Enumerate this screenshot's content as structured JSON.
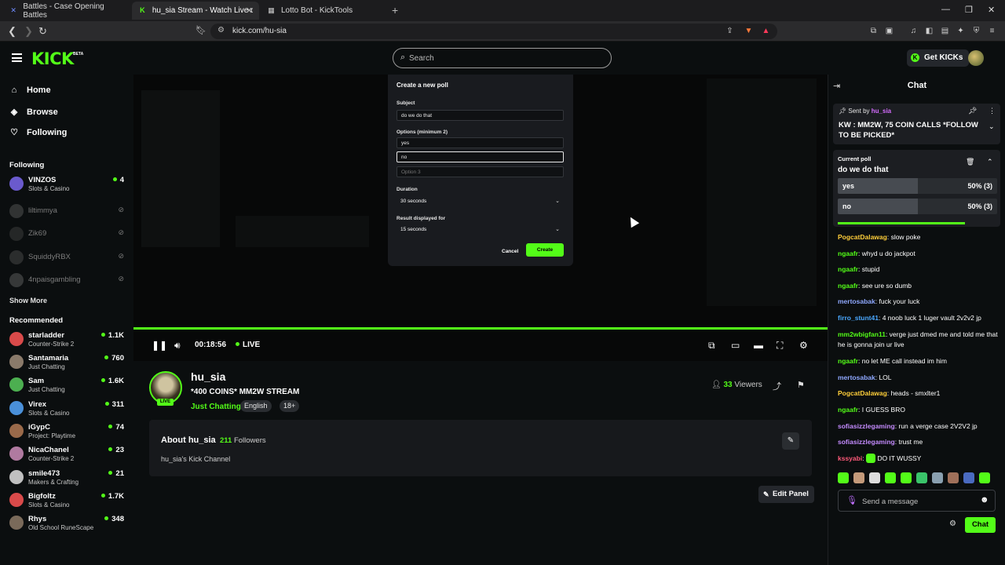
{
  "browser": {
    "tabs": [
      {
        "title": "Battles - Case Opening Battles",
        "icon": "battles-favicon",
        "color": "#6f8cff"
      },
      {
        "title": "hu_sia Stream - Watch Live on Kick",
        "icon": "kick-favicon",
        "color": "#53fc18"
      },
      {
        "title": "Lotto Bot - KickTools",
        "icon": "kicktools-favicon",
        "color": "#cccccc"
      }
    ],
    "url": "kick.com/hu-sia"
  },
  "topbar": {
    "logo": "KICK",
    "logo_badge": "BETA",
    "search_placeholder": "Search",
    "get_kicks_label": "Get KICKs"
  },
  "sidebar": {
    "nav": [
      {
        "label": "Home",
        "icon": "home-icon"
      },
      {
        "label": "Browse",
        "icon": "compass-icon"
      },
      {
        "label": "Following",
        "icon": "heart-icon"
      }
    ],
    "following_title": "Following",
    "following": [
      {
        "name": "VINZOS",
        "category": "Slots & Casino",
        "viewers": "4",
        "live": true,
        "color": "#6a5acd"
      },
      {
        "name": "liltimmya",
        "category": "",
        "viewers": "",
        "live": false,
        "color": "#777777"
      },
      {
        "name": "Zik69",
        "category": "",
        "viewers": "",
        "live": false,
        "color": "#555555"
      },
      {
        "name": "SquiddyRBX",
        "category": "",
        "viewers": "",
        "live": false,
        "color": "#666666"
      },
      {
        "name": "4npaisgambling",
        "category": "",
        "viewers": "",
        "live": false,
        "color": "#888888"
      }
    ],
    "show_more": "Show More",
    "recommended_title": "Recommended",
    "recommended": [
      {
        "name": "starladder",
        "category": "Counter-Strike 2",
        "viewers": "1.1K",
        "color": "#d94a4a"
      },
      {
        "name": "Santamaria",
        "category": "Just Chatting",
        "viewers": "760",
        "color": "#8a7a6a"
      },
      {
        "name": "Sam",
        "category": "Just Chatting",
        "viewers": "1.6K",
        "color": "#4caf50"
      },
      {
        "name": "Virex",
        "category": "Slots & Casino",
        "viewers": "311",
        "color": "#4a90d9"
      },
      {
        "name": "iGypC",
        "category": "Project: Playtime",
        "viewers": "74",
        "color": "#9a6a4a"
      },
      {
        "name": "NicaChanel",
        "category": "Counter-Strike 2",
        "viewers": "23",
        "color": "#b07aa0"
      },
      {
        "name": "smile473",
        "category": "Makers & Crafting",
        "viewers": "21",
        "color": "#c0c0c0"
      },
      {
        "name": "Bigfoltz",
        "category": "Slots & Casino",
        "viewers": "1.7K",
        "color": "#d94a4a"
      },
      {
        "name": "Rhys",
        "category": "Old School RuneScape",
        "viewers": "348",
        "color": "#7a6a5a"
      }
    ]
  },
  "player": {
    "time": "00:18:56",
    "live_label": "LIVE"
  },
  "poll_modal": {
    "title": "Create a new poll",
    "subject_label": "Subject",
    "subject_value": "do we do that",
    "options_label": "Options (minimum 2)",
    "option_values": [
      "yes",
      "no"
    ],
    "option3_placeholder": "Option 3",
    "duration_label": "Duration",
    "duration_value": "30 seconds",
    "result_label": "Result displayed for",
    "result_value": "15 seconds",
    "cancel_label": "Cancel",
    "create_label": "Create"
  },
  "stream": {
    "name": "hu_sia",
    "title": "*400 COINS* MM2W STREAM",
    "category": "Just Chatting",
    "tags": [
      "English",
      "18+"
    ],
    "live_badge": "LIVE",
    "viewers_count": "33",
    "viewers_label": "Viewers"
  },
  "about": {
    "title": "About hu_sia",
    "followers_count": "211",
    "followers_label": "Followers",
    "description": "hu_sia's Kick Channel",
    "edit_panel_label": "Edit Panel"
  },
  "chat": {
    "title": "Chat",
    "pinned": {
      "sent_by_label": "Sent by",
      "sender": "hu_sia",
      "message": "KW : MM2W, 75 COIN CALLS *FOLLOW TO BE PICKED*"
    },
    "poll": {
      "label": "Current poll",
      "question": "do we do that",
      "options": [
        {
          "label": "yes",
          "result": "50% (3)",
          "percent": 50
        },
        {
          "label": "no",
          "result": "50% (3)",
          "percent": 50
        }
      ],
      "time_remaining_fraction": 0.8
    },
    "messages": [
      {
        "user": "PogcatDalawag",
        "text": "slow poke",
        "color": "#ffce3a"
      },
      {
        "user": "ngaafr",
        "text": "whyd u do jackpot",
        "color": "#53fc18"
      },
      {
        "user": "ngaafr",
        "text": "stupid",
        "color": "#53fc18"
      },
      {
        "user": "ngaafr",
        "text": "see ure so dumb",
        "color": "#53fc18"
      },
      {
        "user": "mertosabak",
        "text": "fuck your luck",
        "color": "#8fa8ff"
      },
      {
        "user": "firro_stunt41",
        "text": "4 noob luck 1 luger vault 2v2v2 jp",
        "color": "#4aa8ff"
      },
      {
        "user": "mm2wbigfan11",
        "text": "verge just dmed me and told me that he is gonna join ur live",
        "color": "#53fc18"
      },
      {
        "user": "ngaafr",
        "text": "no let ME call instead im him",
        "color": "#53fc18"
      },
      {
        "user": "mertosabak",
        "text": "LOL",
        "color": "#8fa8ff"
      },
      {
        "user": "PogcatDalawag",
        "text": "heads - smxlter1",
        "color": "#ffce3a"
      },
      {
        "user": "ngaafr",
        "text": "I GUESS BRO",
        "color": "#53fc18"
      },
      {
        "user": "sofiasizzlegaming",
        "text": "run a verge case 2V2V2 jp",
        "color": "#c48bff"
      },
      {
        "user": "sofiasizzlegaming",
        "text": "trust me",
        "color": "#c48bff"
      },
      {
        "user": "kssyabi",
        "text": "DO IT WUSSY",
        "color": "#ff5a7a"
      }
    ],
    "input_placeholder": "Send a message",
    "send_label": "Chat"
  }
}
